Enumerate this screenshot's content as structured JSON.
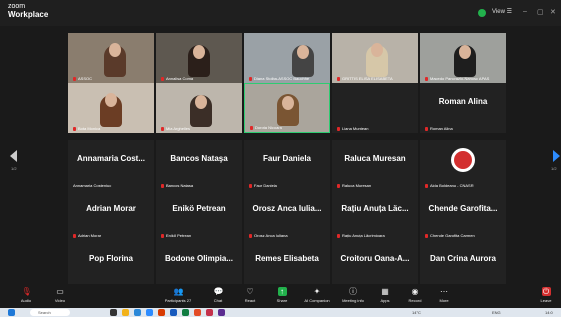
{
  "app": {
    "name_top": "zoom",
    "name_bottom": "Workplace",
    "view_label": "View"
  },
  "video_tiles": [
    {
      "name": "ASSOC"
    },
    {
      "name": "Annalisa Coma"
    },
    {
      "name": "Diana Stolba-ASSOC Bauchhe"
    },
    {
      "name": "GRITTIS ELISA ELISABETA"
    },
    {
      "name": "Macedo Pancrazio-Nanosc APAS"
    },
    {
      "name": "Bota Monica"
    },
    {
      "name": "Mia Arghelles"
    },
    {
      "name": "Dorota Nicoara"
    },
    {
      "name": "Liana Muntean"
    }
  ],
  "name_tiles": [
    {
      "display": "Roman Alina",
      "name": "Roman Alina"
    },
    {
      "display": "Annamaria Cost...",
      "name": "Annamaria Costeniuc"
    },
    {
      "display": "Bancos Nataşa",
      "name": "Bancos Natasa"
    },
    {
      "display": "Faur Daniela",
      "name": "Faur Daniela"
    },
    {
      "display": "Raluca Muresan",
      "name": "Raluca Muresan"
    },
    {
      "display": "",
      "name": "Aida Boldeanu - CNASR"
    },
    {
      "display": "Adrian Morar",
      "name": "Adrian Morar"
    },
    {
      "display": "Enikö Petrean",
      "name": "Enikő Petrean"
    },
    {
      "display": "Orosz Anca Iulia...",
      "name": "Orosz Anca Iuliana"
    },
    {
      "display": "Rațiu Anuța Läc...",
      "name": "Rațiu Anuța Lăcrimioara"
    },
    {
      "display": "Chende Garofita...",
      "name": "Chende Garofita Carmen"
    },
    {
      "display": "Pop Florina",
      "name": "Pop Florina"
    },
    {
      "display": "Bodone Olimpia...",
      "name": "Bodone Olimpia Maria"
    },
    {
      "display": "Remes Elisabeta",
      "name": "Remes Elisabeta"
    },
    {
      "display": "Croitoru Oana-A...",
      "name": "Croitoru Oana Alexandra"
    },
    {
      "display": "Dan Crina Aurora",
      "name": "Dan Crina Aurora"
    }
  ],
  "pages": {
    "left": "1/2",
    "right": "1/2"
  },
  "toolbar": {
    "audio": "Audio",
    "video": "Video",
    "participants": "Participants",
    "participants_count": "27",
    "chat": "Chat",
    "react": "React",
    "share": "Share",
    "ai_companion": "AI Companion",
    "meeting_info": "Meeting info",
    "apps": "Apps",
    "record": "Record",
    "more": "More",
    "leave": "Leave"
  },
  "taskbar": {
    "search_placeholder": "Search",
    "weather": "14°C",
    "lang": "ENG",
    "time": "14:0"
  },
  "colors": {
    "active_speaker": "#2ecc71",
    "muted": "#e02828",
    "share": "#22b14c",
    "leave": "#d32f2f"
  }
}
